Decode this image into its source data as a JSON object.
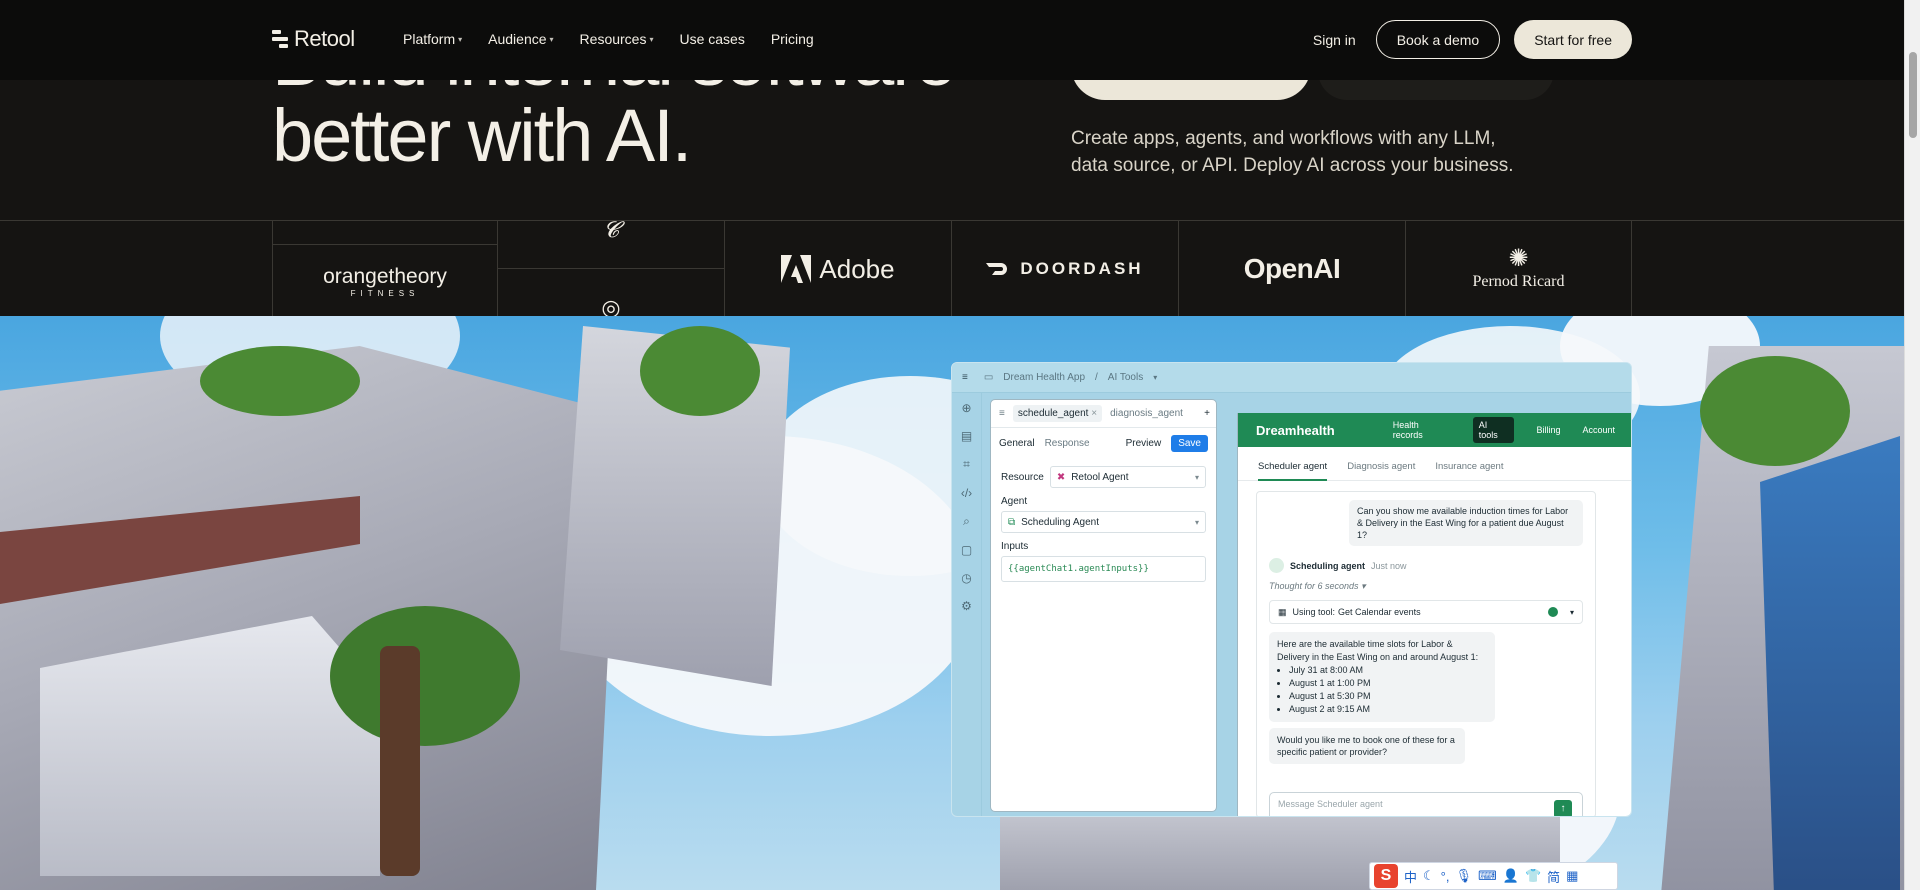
{
  "nav": {
    "brand": "Retool",
    "links": [
      "Platform",
      "Audience",
      "Resources",
      "Use cases",
      "Pricing"
    ],
    "sign_in": "Sign in",
    "book_demo": "Book a demo",
    "start_free": "Start for free"
  },
  "hero": {
    "title_line1": "Build internal software",
    "title_line2": "better with AI.",
    "subtitle": "Create apps, agents, and workflows with any LLM, data source, or API. Deploy AI across your business."
  },
  "logos": [
    "Adobe",
    "DOORDASH",
    "OpenAI",
    "Pernod Ricard",
    "orangetheory",
    "FITNESS"
  ],
  "app": {
    "breadcrumb_app": "Dream Health App",
    "breadcrumb_sep": "/",
    "breadcrumb_page": "AI Tools",
    "tab_active": "schedule_agent",
    "tab_other": "diagnosis_agent",
    "general": "General",
    "response": "Response",
    "preview": "Preview",
    "save": "Save",
    "resource_label": "Resource",
    "resource_value": "Retool Agent",
    "agent_label": "Agent",
    "agent_value": "Scheduling Agent",
    "inputs_label": "Inputs",
    "inputs_value": "{{agentChat1.agentInputs}}"
  },
  "dreamhealth": {
    "brand": "Dreamhealth",
    "nav": [
      "Health records",
      "AI tools",
      "Billing",
      "Account"
    ],
    "tabs": [
      "Scheduler agent",
      "Diagnosis agent",
      "Insurance agent"
    ],
    "user_msg": "Can you show me available induction times for Labor & Delivery in the East Wing for a patient due August 1?",
    "agent_name": "Scheduling agent",
    "agent_time": "Just now",
    "thought": "Thought for 6 seconds",
    "tool_prefix": "Using tool:",
    "tool_name": "Get Calendar events",
    "reply_intro": "Here are the available time slots for Labor & Delivery in the East Wing on and around August 1:",
    "slots": [
      "July 31 at 8:00 AM",
      "August 1 at 1:00 PM",
      "August 1 at 5:30 PM",
      "August 2 at 9:15 AM"
    ],
    "followup": "Would you like me to book one of these for a specific patient or provider?",
    "placeholder": "Message Scheduler agent"
  },
  "ime": {
    "items": [
      "中",
      "简"
    ]
  }
}
